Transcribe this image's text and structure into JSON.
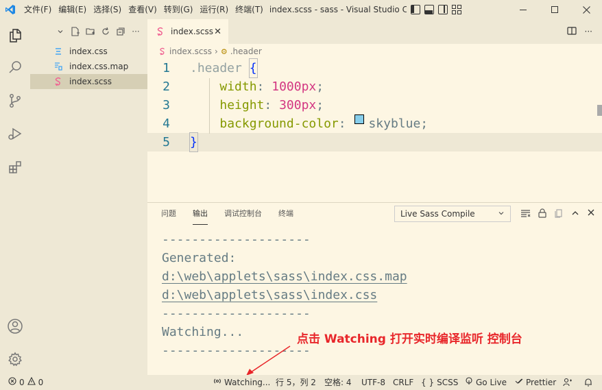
{
  "titlebar": {
    "menu": [
      "文件(F)",
      "编辑(E)",
      "选择(S)",
      "查看(V)",
      "转到(G)",
      "运行(R)",
      "终端(T)"
    ],
    "title": "index.scss - sass - Visual Studio Cod..."
  },
  "explorer": {
    "files": [
      {
        "name": "index.css",
        "icon": "css-file-icon",
        "color": "#42A5F5"
      },
      {
        "name": "index.css.map",
        "icon": "map-file-icon",
        "color": "#42A5F5"
      },
      {
        "name": "index.scss",
        "icon": "scss-file-icon",
        "color": "#F06292"
      }
    ]
  },
  "editor": {
    "tab": "index.scss",
    "breadcrumb": {
      "file": "index.scss",
      "symbol": ".header"
    },
    "lines": [
      {
        "n": "1",
        "sel": ".header",
        "brace": "{"
      },
      {
        "n": "2",
        "prop": "width",
        "num": "1000",
        "unit": "px"
      },
      {
        "n": "3",
        "prop": "height",
        "num": "300",
        "unit": "px"
      },
      {
        "n": "4",
        "prop": "background-color",
        "val": "skyblue"
      },
      {
        "n": "5",
        "brace": "}"
      }
    ],
    "swatch_color": "#87CEEB"
  },
  "panel": {
    "tabs": [
      "问题",
      "输出",
      "调试控制台",
      "终端"
    ],
    "active_tab": "输出",
    "channel": "Live Sass Compile",
    "output": [
      "--------------------",
      "Generated:",
      "d:\\web\\applets\\sass\\index.css.map",
      "d:\\web\\applets\\sass\\index.css",
      "--------------------",
      "Watching...",
      "--------------------"
    ]
  },
  "annotation": "点击 Watching 打开实时编译监听 控制台",
  "statusbar": {
    "errors": "0",
    "warnings": "0",
    "watching": "Watching...",
    "position": "行 5，列 2",
    "spaces": "空格: 4",
    "encoding": "UTF-8",
    "eol": "CRLF",
    "language": "SCSS",
    "golive": "Go Live",
    "prettier": "Prettier"
  }
}
